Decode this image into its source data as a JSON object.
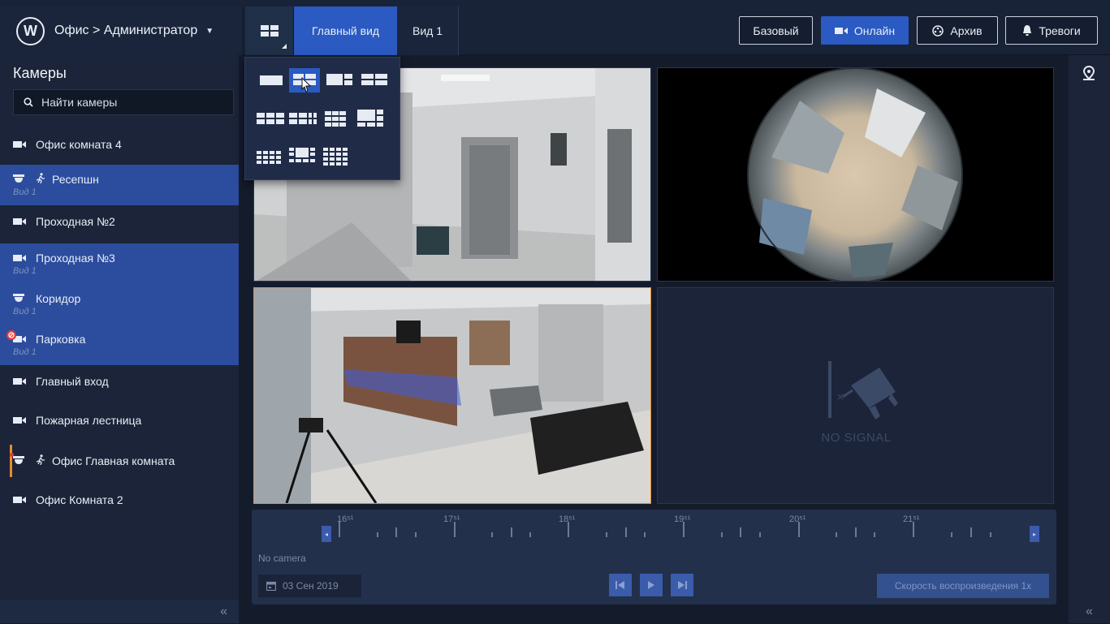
{
  "header": {
    "logo_letter": "W",
    "title": "Офис > Администратор",
    "tabs": [
      {
        "label": "Главный вид",
        "active": true
      },
      {
        "label": "Вид 1",
        "active": false
      }
    ],
    "buttons": {
      "base": "Базовый",
      "online": "Онлайн",
      "archive": "Архив",
      "alarms": "Тревоги"
    }
  },
  "sidebar": {
    "title": "Камеры",
    "search_placeholder": "Найти камеры",
    "cameras": [
      {
        "name": "Офис комната 4",
        "sub": "",
        "selected": false,
        "icon": "camera-icon"
      },
      {
        "name": "Ресепшн",
        "sub": "Вид 1",
        "selected": true,
        "icon": "dome-camera-icon",
        "motion": true
      },
      {
        "name": "Проходная №2",
        "sub": "",
        "selected": false,
        "icon": "camera-icon"
      },
      {
        "name": "Проходная №3",
        "sub": "Вид 1",
        "selected": true,
        "icon": "camera-icon"
      },
      {
        "name": "Коридор",
        "sub": "Вид 1",
        "selected": true,
        "icon": "dome-camera-icon"
      },
      {
        "name": "Парковка",
        "sub": "Вид 1",
        "selected": true,
        "icon": "camera-icon",
        "error": true
      },
      {
        "name": "Главный вход",
        "sub": "",
        "selected": false,
        "icon": "camera-icon"
      },
      {
        "name": "Пожарная лестница",
        "sub": "",
        "selected": false,
        "icon": "camera-icon"
      },
      {
        "name": "Офис Главная комната",
        "sub": "",
        "selected": false,
        "icon": "dome-camera-icon",
        "motion": true,
        "active": true
      },
      {
        "name": "Офис Комната 2",
        "sub": "",
        "selected": false,
        "icon": "camera-icon"
      }
    ]
  },
  "tiles": {
    "no_signal": "NO SIGNAL"
  },
  "timeline": {
    "ticks": [
      "16⁵¹",
      "17⁵¹",
      "18⁵¹",
      "19⁵¹",
      "20⁵¹",
      "21⁵¹"
    ],
    "no_camera": "No camera",
    "date": "03 Сен 2019",
    "speed": "Скорость воспроизведения 1x"
  },
  "colors": {
    "accent": "#2a5ac2",
    "selected_row": "#2c4d9e",
    "active_border": "#e98b2a",
    "error": "#e23a3a"
  }
}
